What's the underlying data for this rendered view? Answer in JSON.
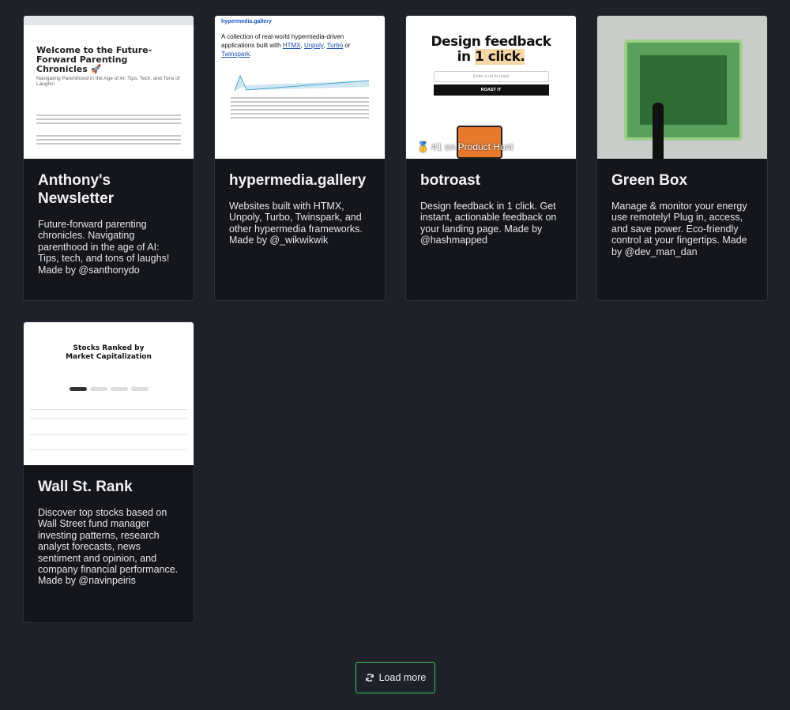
{
  "projects": [
    {
      "title": "Anthony's Newsletter",
      "description": "Future-forward parenting chronicles. Navigating parenthood in the age of AI: Tips, tech, and tons of laughs! Made by @santhonydo",
      "thumb_heading": "Welcome to the Future-Forward Parenting Chronicles 🚀",
      "thumb_subheading": "Navigating Parenthood in the Age of AI: Tips, Tech, and Tons of Laughs!"
    },
    {
      "title": "hypermedia.gallery",
      "description": "Websites built with HTMX, Unpoly, Turbo, Twinspark, and other hypermedia frameworks. Made by @_wikwikwik",
      "thumb_logo": "hypermedia.gallery",
      "thumb_heading_prefix": "A collection of real-world hypermedia-driven applications built with ",
      "thumb_links": [
        "HTMX",
        "Unpoly",
        "Turbo",
        "Twinspark"
      ]
    },
    {
      "title": "botroast",
      "description": "Design feedback in 1 click. Get instant, actionable feedback on your landing page. Made by @hashmapped",
      "thumb_heading_line1": "Design feedback",
      "thumb_heading_in": "in ",
      "thumb_heading_highlight": "1 click.",
      "thumb_input_placeholder": "Enter a url to roast",
      "thumb_button": "ROAST IT",
      "thumb_badge": "🥇 #1 on Product Hunt"
    },
    {
      "title": "Green Box",
      "description": "Manage & monitor your energy use remotely! Plug in, access, and save power. Eco-friendly control at your fingertips. Made by @dev_man_dan"
    },
    {
      "title": "Wall St. Rank",
      "description": "Discover top stocks based on Wall Street fund manager investing patterns, research analyst forecasts, news sentiment and opinion, and company financial performance. Made by @navinpeiris",
      "thumb_heading": "Stocks Ranked by Market Capitalization"
    }
  ],
  "load_more_label": "Load more",
  "colors": {
    "background": "#1f2128",
    "card": "#15161b",
    "button_border": "#3ec15d"
  }
}
